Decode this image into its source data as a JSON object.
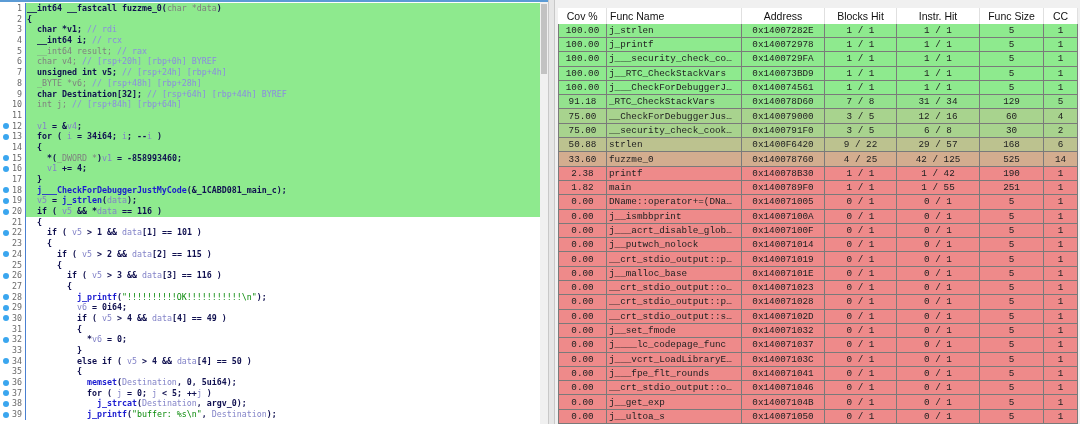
{
  "code_view": {
    "lines": [
      {
        "number": "1",
        "breakpoint": false,
        "highlighted": true,
        "tokens": [
          {
            "kind": "t",
            "text": "__int64 __fastcall fuzzme_0("
          },
          {
            "kind": "g",
            "text": "char *data"
          },
          {
            "kind": "t",
            "text": ")"
          }
        ]
      },
      {
        "number": "2",
        "breakpoint": false,
        "highlighted": true,
        "tokens": [
          {
            "kind": "t",
            "text": "{"
          }
        ]
      },
      {
        "number": "3",
        "breakpoint": false,
        "highlighted": true,
        "tokens": [
          {
            "kind": "t",
            "text": "  char *v1; "
          },
          {
            "kind": "c",
            "text": "// rdi"
          }
        ]
      },
      {
        "number": "4",
        "breakpoint": false,
        "highlighted": true,
        "tokens": [
          {
            "kind": "t",
            "text": "  __int64 i; "
          },
          {
            "kind": "c",
            "text": "// rcx"
          }
        ]
      },
      {
        "number": "5",
        "breakpoint": false,
        "highlighted": true,
        "tokens": [
          {
            "kind": "g",
            "text": "  __int64 result; "
          },
          {
            "kind": "c",
            "text": "// rax"
          }
        ]
      },
      {
        "number": "6",
        "breakpoint": false,
        "highlighted": true,
        "tokens": [
          {
            "kind": "g",
            "text": "  char v4; "
          },
          {
            "kind": "c",
            "text": "// [rsp+20h] [rbp+0h] BYREF"
          }
        ]
      },
      {
        "number": "7",
        "breakpoint": false,
        "highlighted": true,
        "tokens": [
          {
            "kind": "t",
            "text": "  unsigned int v5; "
          },
          {
            "kind": "c",
            "text": "// [rsp+24h] [rbp+4h]"
          }
        ]
      },
      {
        "number": "8",
        "breakpoint": false,
        "highlighted": true,
        "tokens": [
          {
            "kind": "g",
            "text": "  _BYTE *v6; "
          },
          {
            "kind": "c",
            "text": "// [rsp+48h] [rbp+28h]"
          }
        ]
      },
      {
        "number": "9",
        "breakpoint": false,
        "highlighted": true,
        "tokens": [
          {
            "kind": "t",
            "text": "  char Destination[32]; "
          },
          {
            "kind": "c",
            "text": "// [rsp+64h] [rbp+44h] BYREF"
          }
        ]
      },
      {
        "number": "10",
        "breakpoint": false,
        "highlighted": true,
        "tokens": [
          {
            "kind": "g",
            "text": "  int j; "
          },
          {
            "kind": "c",
            "text": "// [rsp+84h] [rbp+64h]"
          }
        ]
      },
      {
        "number": "11",
        "breakpoint": false,
        "highlighted": true
      },
      {
        "number": "12",
        "breakpoint": true,
        "highlighted": true,
        "tokens": [
          {
            "kind": "v",
            "text": "  v1"
          },
          {
            "kind": "t",
            "text": " = &"
          },
          {
            "kind": "v",
            "text": "v4"
          },
          {
            "kind": "t",
            "text": ";"
          }
        ]
      },
      {
        "number": "13",
        "breakpoint": true,
        "highlighted": true,
        "tokens": [
          {
            "kind": "t",
            "text": "  for ( "
          },
          {
            "kind": "v",
            "text": "i"
          },
          {
            "kind": "t",
            "text": " = 34i64; "
          },
          {
            "kind": "v",
            "text": "i"
          },
          {
            "kind": "t",
            "text": "; --"
          },
          {
            "kind": "v",
            "text": "i"
          },
          {
            "kind": "t",
            "text": " )"
          }
        ]
      },
      {
        "number": "14",
        "breakpoint": false,
        "highlighted": true,
        "tokens": [
          {
            "kind": "t",
            "text": "  {"
          }
        ]
      },
      {
        "number": "15",
        "breakpoint": true,
        "highlighted": true,
        "tokens": [
          {
            "kind": "t",
            "text": "    *("
          },
          {
            "kind": "g",
            "text": "_DWORD *"
          },
          {
            "kind": "t",
            "text": ")"
          },
          {
            "kind": "v",
            "text": "v1"
          },
          {
            "kind": "t",
            "text": " = -858993460;"
          }
        ]
      },
      {
        "number": "16",
        "breakpoint": true,
        "highlighted": true,
        "tokens": [
          {
            "kind": "v",
            "text": "    v1"
          },
          {
            "kind": "t",
            "text": " += 4;"
          }
        ]
      },
      {
        "number": "17",
        "breakpoint": false,
        "highlighted": true,
        "tokens": [
          {
            "kind": "t",
            "text": "  }"
          }
        ]
      },
      {
        "number": "18",
        "breakpoint": true,
        "highlighted": true,
        "tokens": [
          {
            "kind": "f",
            "text": "  j___CheckForDebuggerJustMyCode"
          },
          {
            "kind": "t",
            "text": "(&_1CABD081_main_c);"
          }
        ]
      },
      {
        "number": "19",
        "breakpoint": true,
        "highlighted": true,
        "tokens": [
          {
            "kind": "v",
            "text": "  v5"
          },
          {
            "kind": "t",
            "text": " = "
          },
          {
            "kind": "f",
            "text": "j_strlen"
          },
          {
            "kind": "t",
            "text": "("
          },
          {
            "kind": "v",
            "text": "data"
          },
          {
            "kind": "t",
            "text": ");"
          }
        ]
      },
      {
        "number": "20",
        "breakpoint": true,
        "highlighted": true,
        "tokens": [
          {
            "kind": "t",
            "text": "  if ( "
          },
          {
            "kind": "v",
            "text": "v5"
          },
          {
            "kind": "t",
            "text": " && *"
          },
          {
            "kind": "v",
            "text": "data"
          },
          {
            "kind": "t",
            "text": " == 116 )"
          }
        ]
      },
      {
        "number": "21",
        "breakpoint": false,
        "highlighted": false,
        "tokens": [
          {
            "kind": "t",
            "text": "  {"
          }
        ]
      },
      {
        "number": "22",
        "breakpoint": true,
        "highlighted": false,
        "tokens": [
          {
            "kind": "t",
            "text": "    if ( "
          },
          {
            "kind": "v",
            "text": "v5"
          },
          {
            "kind": "t",
            "text": " > 1 && "
          },
          {
            "kind": "v",
            "text": "data"
          },
          {
            "kind": "t",
            "text": "[1] == 101 )"
          }
        ]
      },
      {
        "number": "23",
        "breakpoint": false,
        "highlighted": false,
        "tokens": [
          {
            "kind": "t",
            "text": "    {"
          }
        ]
      },
      {
        "number": "24",
        "breakpoint": true,
        "highlighted": false,
        "tokens": [
          {
            "kind": "t",
            "text": "      if ( "
          },
          {
            "kind": "v",
            "text": "v5"
          },
          {
            "kind": "t",
            "text": " > 2 && "
          },
          {
            "kind": "v",
            "text": "data"
          },
          {
            "kind": "t",
            "text": "[2] == 115 )"
          }
        ]
      },
      {
        "number": "25",
        "breakpoint": false,
        "highlighted": false,
        "tokens": [
          {
            "kind": "t",
            "text": "      {"
          }
        ]
      },
      {
        "number": "26",
        "breakpoint": true,
        "highlighted": false,
        "tokens": [
          {
            "kind": "t",
            "text": "        if ( "
          },
          {
            "kind": "v",
            "text": "v5"
          },
          {
            "kind": "t",
            "text": " > 3 && "
          },
          {
            "kind": "v",
            "text": "data"
          },
          {
            "kind": "t",
            "text": "[3] == 116 )"
          }
        ]
      },
      {
        "number": "27",
        "breakpoint": false,
        "highlighted": false,
        "tokens": [
          {
            "kind": "t",
            "text": "        {"
          }
        ]
      },
      {
        "number": "28",
        "breakpoint": true,
        "highlighted": false,
        "tokens": [
          {
            "kind": "f",
            "text": "          j_printf"
          },
          {
            "kind": "t",
            "text": "("
          },
          {
            "kind": "s",
            "text": "\"!!!!!!!!!!OK!!!!!!!!!!!\\n\""
          },
          {
            "kind": "t",
            "text": ");"
          }
        ]
      },
      {
        "number": "29",
        "breakpoint": true,
        "highlighted": false,
        "tokens": [
          {
            "kind": "v",
            "text": "          v6"
          },
          {
            "kind": "t",
            "text": " = 0i64;"
          }
        ]
      },
      {
        "number": "30",
        "breakpoint": true,
        "highlighted": false,
        "tokens": [
          {
            "kind": "t",
            "text": "          if ( "
          },
          {
            "kind": "v",
            "text": "v5"
          },
          {
            "kind": "t",
            "text": " > 4 && "
          },
          {
            "kind": "v",
            "text": "data"
          },
          {
            "kind": "t",
            "text": "[4] == 49 )"
          }
        ]
      },
      {
        "number": "31",
        "breakpoint": false,
        "highlighted": false,
        "tokens": [
          {
            "kind": "t",
            "text": "          {"
          }
        ]
      },
      {
        "number": "32",
        "breakpoint": true,
        "highlighted": false,
        "tokens": [
          {
            "kind": "t",
            "text": "            *"
          },
          {
            "kind": "v",
            "text": "v6"
          },
          {
            "kind": "t",
            "text": " = 0;"
          }
        ]
      },
      {
        "number": "33",
        "breakpoint": false,
        "highlighted": false,
        "tokens": [
          {
            "kind": "t",
            "text": "          }"
          }
        ]
      },
      {
        "number": "34",
        "breakpoint": true,
        "highlighted": false,
        "tokens": [
          {
            "kind": "t",
            "text": "          else if ( "
          },
          {
            "kind": "v",
            "text": "v5"
          },
          {
            "kind": "t",
            "text": " > 4 && "
          },
          {
            "kind": "v",
            "text": "data"
          },
          {
            "kind": "t",
            "text": "[4] == 50 )"
          }
        ]
      },
      {
        "number": "35",
        "breakpoint": false,
        "highlighted": false,
        "tokens": [
          {
            "kind": "t",
            "text": "          {"
          }
        ]
      },
      {
        "number": "36",
        "breakpoint": true,
        "highlighted": false,
        "tokens": [
          {
            "kind": "f",
            "text": "            memset"
          },
          {
            "kind": "t",
            "text": "("
          },
          {
            "kind": "v",
            "text": "Destination"
          },
          {
            "kind": "t",
            "text": ", 0, 5ui64);"
          }
        ]
      },
      {
        "number": "37",
        "breakpoint": true,
        "highlighted": false,
        "tokens": [
          {
            "kind": "t",
            "text": "            for ( "
          },
          {
            "kind": "v",
            "text": "j"
          },
          {
            "kind": "t",
            "text": " = 0; "
          },
          {
            "kind": "v",
            "text": "j"
          },
          {
            "kind": "t",
            "text": " < 5; ++"
          },
          {
            "kind": "v",
            "text": "j"
          },
          {
            "kind": "t",
            "text": " )"
          }
        ]
      },
      {
        "number": "38",
        "breakpoint": true,
        "highlighted": false,
        "tokens": [
          {
            "kind": "f",
            "text": "              j_strcat"
          },
          {
            "kind": "t",
            "text": "("
          },
          {
            "kind": "v",
            "text": "Destination"
          },
          {
            "kind": "t",
            "text": ", argv_0);"
          }
        ]
      },
      {
        "number": "39",
        "breakpoint": true,
        "highlighted": false,
        "tokens": [
          {
            "kind": "f",
            "text": "            j_printf"
          },
          {
            "kind": "t",
            "text": "("
          },
          {
            "kind": "s",
            "text": "\"buffer: %s\\n\""
          },
          {
            "kind": "t",
            "text": ", "
          },
          {
            "kind": "v",
            "text": "Destination"
          },
          {
            "kind": "t",
            "text": ");"
          }
        ]
      }
    ]
  },
  "coverage_table": {
    "columns": [
      "Cov %",
      "Func Name",
      "Address",
      "Blocks Hit",
      "Instr. Hit",
      "Func Size",
      "CC"
    ],
    "rows": [
      {
        "color": "#8eea8e",
        "cells": [
          "100.00",
          "j_strlen",
          "0x14007282E",
          "1 / 1",
          "1 / 1",
          "5",
          "1"
        ]
      },
      {
        "color": "#8eea8e",
        "cells": [
          "100.00",
          "j_printf",
          "0x140072978",
          "1 / 1",
          "1 / 1",
          "5",
          "1"
        ]
      },
      {
        "color": "#8eea8e",
        "cells": [
          "100.00",
          "j___security_check_co…",
          "0x1400729FA",
          "1 / 1",
          "1 / 1",
          "5",
          "1"
        ]
      },
      {
        "color": "#8eea8e",
        "cells": [
          "100.00",
          "j__RTC_CheckStackVars",
          "0x140073BD9",
          "1 / 1",
          "1 / 1",
          "5",
          "1"
        ]
      },
      {
        "color": "#8eea8e",
        "cells": [
          "100.00",
          "j___CheckForDebuggerJ…",
          "0x140074561",
          "1 / 1",
          "1 / 1",
          "5",
          "1"
        ]
      },
      {
        "color": "#94e28e",
        "cells": [
          "91.18",
          "_RTC_CheckStackVars",
          "0x140078D60",
          "7 / 8",
          "31 / 34",
          "129",
          "5"
        ]
      },
      {
        "color": "#a8d38e",
        "cells": [
          "75.00",
          "__CheckForDebuggerJus…",
          "0x140079000",
          "3 / 5",
          "12 / 16",
          "60",
          "4"
        ]
      },
      {
        "color": "#a8d38e",
        "cells": [
          "75.00",
          "__security_check_cook…",
          "0x1400791F0",
          "3 / 5",
          "6 / 8",
          "30",
          "2"
        ]
      },
      {
        "color": "#bcc28f",
        "cells": [
          "50.88",
          "strlen",
          "0x1400F6420",
          "9 / 22",
          "29 / 57",
          "168",
          "6"
        ]
      },
      {
        "color": "#d3ad8f",
        "cells": [
          "33.60",
          "fuzzme_0",
          "0x140078760",
          "4 / 25",
          "42 / 125",
          "525",
          "14"
        ]
      },
      {
        "color": "#ee8a8a",
        "cells": [
          "2.38",
          "printf",
          "0x140078B30",
          "1 / 1",
          "1 / 42",
          "190",
          "1"
        ]
      },
      {
        "color": "#ee8a8a",
        "cells": [
          "1.82",
          "main",
          "0x1400789F0",
          "1 / 1",
          "1 / 55",
          "251",
          "1"
        ]
      },
      {
        "color": "#ee8a8a",
        "cells": [
          "0.00",
          "DName::operator+=(DNa…",
          "0x140071005",
          "0 / 1",
          "0 / 1",
          "5",
          "1"
        ]
      },
      {
        "color": "#ee8a8a",
        "cells": [
          "0.00",
          "j__ismbbprint",
          "0x14007100A",
          "0 / 1",
          "0 / 1",
          "5",
          "1"
        ]
      },
      {
        "color": "#ee8a8a",
        "cells": [
          "0.00",
          "j___acrt_disable_glob…",
          "0x14007100F",
          "0 / 1",
          "0 / 1",
          "5",
          "1"
        ]
      },
      {
        "color": "#ee8a8a",
        "cells": [
          "0.00",
          "j__putwch_nolock",
          "0x140071014",
          "0 / 1",
          "0 / 1",
          "5",
          "1"
        ]
      },
      {
        "color": "#ee8a8a",
        "cells": [
          "0.00",
          "__crt_stdio_output::p…",
          "0x140071019",
          "0 / 1",
          "0 / 1",
          "5",
          "1"
        ]
      },
      {
        "color": "#ee8a8a",
        "cells": [
          "0.00",
          "j__malloc_base",
          "0x14007101E",
          "0 / 1",
          "0 / 1",
          "5",
          "1"
        ]
      },
      {
        "color": "#ee8a8a",
        "cells": [
          "0.00",
          "__crt_stdio_output::o…",
          "0x140071023",
          "0 / 1",
          "0 / 1",
          "5",
          "1"
        ]
      },
      {
        "color": "#ee8a8a",
        "cells": [
          "0.00",
          "__crt_stdio_output::p…",
          "0x140071028",
          "0 / 1",
          "0 / 1",
          "5",
          "1"
        ]
      },
      {
        "color": "#ee8a8a",
        "cells": [
          "0.00",
          "__crt_stdio_output::s…",
          "0x14007102D",
          "0 / 1",
          "0 / 1",
          "5",
          "1"
        ]
      },
      {
        "color": "#ee8a8a",
        "cells": [
          "0.00",
          "j__set_fmode",
          "0x140071032",
          "0 / 1",
          "0 / 1",
          "5",
          "1"
        ]
      },
      {
        "color": "#ee8a8a",
        "cells": [
          "0.00",
          "j____lc_codepage_func",
          "0x140071037",
          "0 / 1",
          "0 / 1",
          "5",
          "1"
        ]
      },
      {
        "color": "#ee8a8a",
        "cells": [
          "0.00",
          "j___vcrt_LoadLibraryE…",
          "0x14007103C",
          "0 / 1",
          "0 / 1",
          "5",
          "1"
        ]
      },
      {
        "color": "#ee8a8a",
        "cells": [
          "0.00",
          "j___fpe_flt_rounds",
          "0x140071041",
          "0 / 1",
          "0 / 1",
          "5",
          "1"
        ]
      },
      {
        "color": "#ee8a8a",
        "cells": [
          "0.00",
          "__crt_stdio_output::o…",
          "0x140071046",
          "0 / 1",
          "0 / 1",
          "5",
          "1"
        ]
      },
      {
        "color": "#ee8a8a",
        "cells": [
          "0.00",
          "j__get_exp",
          "0x14007104B",
          "0 / 1",
          "0 / 1",
          "5",
          "1"
        ]
      },
      {
        "color": "#ee8a8a",
        "cells": [
          "0.00",
          "j__ultoa_s",
          "0x140071050",
          "0 / 1",
          "0 / 1",
          "5",
          "1"
        ]
      }
    ]
  }
}
